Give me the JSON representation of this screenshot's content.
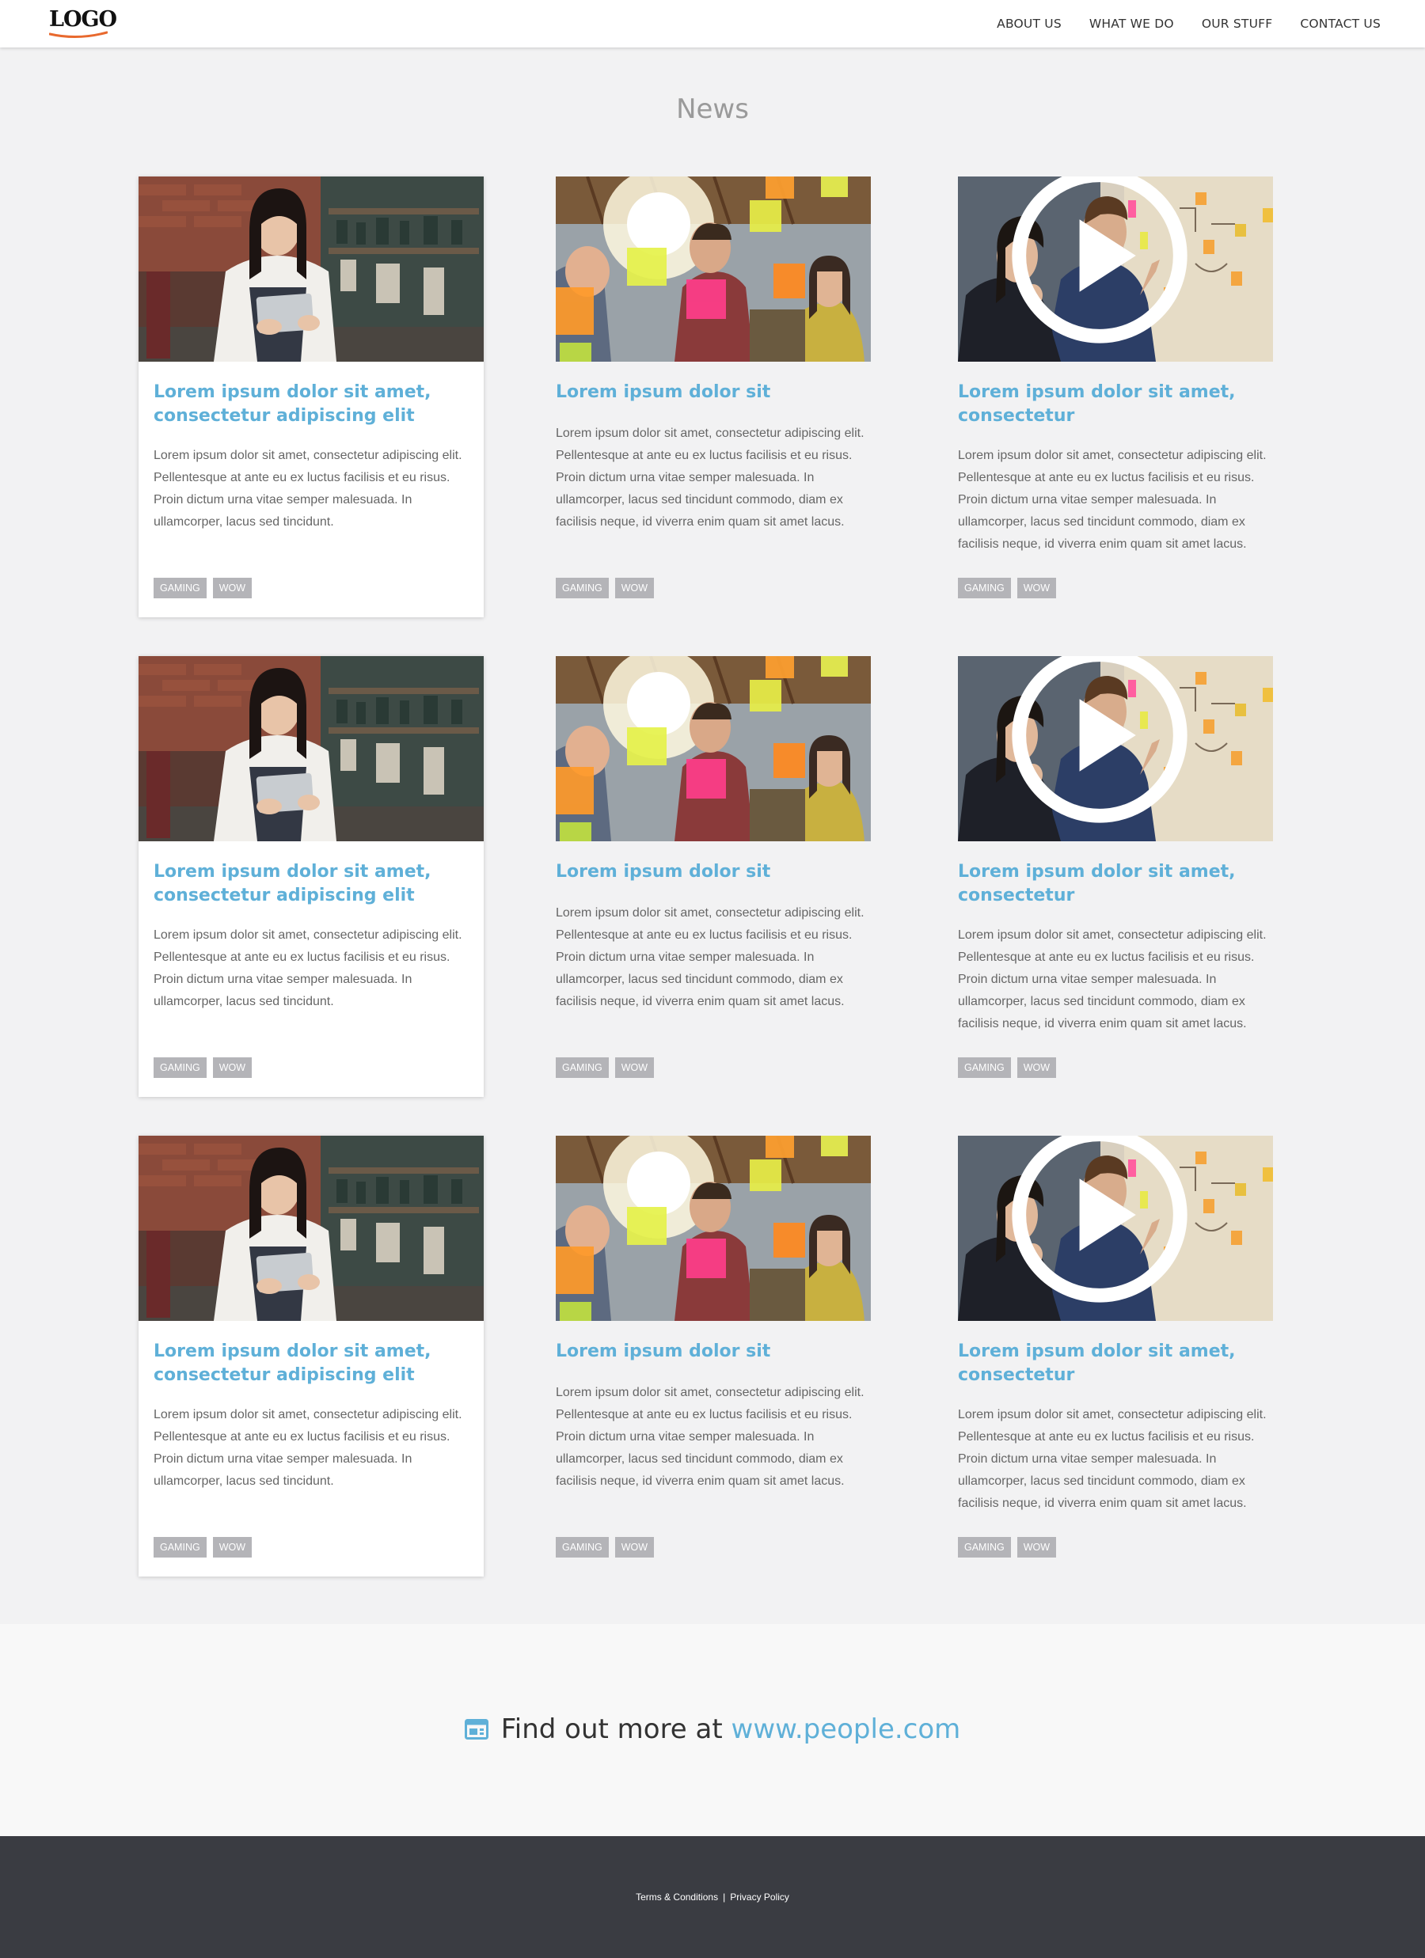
{
  "header": {
    "logo": "LOGO",
    "nav": [
      "ABOUT US",
      "WHAT WE DO",
      "OUR STUFF",
      "CONTACT US"
    ]
  },
  "page_title": "News",
  "cards": [
    {
      "image": "woman-with-tablet-photo",
      "title": "Lorem ipsum dolor sit amet, consectetur adipiscing elit",
      "text": "Lorem ipsum dolor sit amet, consectetur adipiscing elit. Pellentesque at ante eu ex luctus facilisis et eu risus. Proin dictum urna vitae semper malesuada. In ullamcorper, lacus sed tincidunt.",
      "tags": [
        "GAMING",
        "WOW"
      ]
    },
    {
      "image": "team-sticky-notes-glass-photo",
      "title": "Lorem ipsum dolor sit",
      "text": "Lorem ipsum dolor sit amet, consectetur adipiscing elit. Pellentesque at ante eu ex luctus facilisis et eu risus. Proin dictum urna vitae semper malesuada. In ullamcorper, lacus sed tincidunt commodo, diam ex facilisis neque, id viverra enim quam sit amet lacus.",
      "tags": [
        "GAMING",
        "WOW"
      ]
    },
    {
      "image": "couple-whiteboard-video-thumbnail",
      "title": "Lorem ipsum dolor sit amet, consectetur",
      "text": "Lorem ipsum dolor sit amet, consectetur adipiscing elit. Pellentesque at ante eu ex luctus facilisis et eu risus. Proin dictum urna vitae semper malesuada. In ullamcorper, lacus sed tincidunt commodo, diam ex facilisis neque, id viverra enim quam sit amet lacus.",
      "tags": [
        "GAMING",
        "WOW"
      ]
    },
    {
      "image": "woman-with-tablet-photo",
      "title": "Lorem ipsum dolor sit amet, consectetur adipiscing elit",
      "text": "Lorem ipsum dolor sit amet, consectetur adipiscing elit. Pellentesque at ante eu ex luctus facilisis et eu risus. Proin dictum urna vitae semper malesuada. In ullamcorper, lacus sed tincidunt.",
      "tags": [
        "GAMING",
        "WOW"
      ]
    },
    {
      "image": "team-sticky-notes-glass-photo",
      "title": "Lorem ipsum dolor sit",
      "text": "Lorem ipsum dolor sit amet, consectetur adipiscing elit. Pellentesque at ante eu ex luctus facilisis et eu risus. Proin dictum urna vitae semper malesuada. In ullamcorper, lacus sed tincidunt commodo, diam ex facilisis neque, id viverra enim quam sit amet lacus.",
      "tags": [
        "GAMING",
        "WOW"
      ]
    },
    {
      "image": "couple-whiteboard-video-thumbnail",
      "title": "Lorem ipsum dolor sit amet, consectetur",
      "text": "Lorem ipsum dolor sit amet, consectetur adipiscing elit. Pellentesque at ante eu ex luctus facilisis et eu risus. Proin dictum urna vitae semper malesuada. In ullamcorper, lacus sed tincidunt commodo, diam ex facilisis neque, id viverra enim quam sit amet lacus.",
      "tags": [
        "GAMING",
        "WOW"
      ]
    },
    {
      "image": "woman-with-tablet-photo",
      "title": "Lorem ipsum dolor sit amet, consectetur adipiscing elit",
      "text": "Lorem ipsum dolor sit amet, consectetur adipiscing elit. Pellentesque at ante eu ex luctus facilisis et eu risus. Proin dictum urna vitae semper malesuada. In ullamcorper, lacus sed tincidunt.",
      "tags": [
        "GAMING",
        "WOW"
      ]
    },
    {
      "image": "team-sticky-notes-glass-photo",
      "title": "Lorem ipsum dolor sit",
      "text": "Lorem ipsum dolor sit amet, consectetur adipiscing elit. Pellentesque at ante eu ex luctus facilisis et eu risus. Proin dictum urna vitae semper malesuada. In ullamcorper, lacus sed tincidunt commodo, diam ex facilisis neque, id viverra enim quam sit amet lacus.",
      "tags": [
        "GAMING",
        "WOW"
      ]
    },
    {
      "image": "couple-whiteboard-video-thumbnail",
      "title": "Lorem ipsum dolor sit amet, consectetur",
      "text": "Lorem ipsum dolor sit amet, consectetur adipiscing elit. Pellentesque at ante eu ex luctus facilisis et eu risus. Proin dictum urna vitae semper malesuada. In ullamcorper, lacus sed tincidunt commodo, diam ex facilisis neque, id viverra enim quam sit amet lacus.",
      "tags": [
        "GAMING",
        "WOW"
      ]
    }
  ],
  "find_more": {
    "icon": "browser-window-icon",
    "prefix": "Find out more at",
    "link": "www.people.com"
  },
  "footer": {
    "terms": "Terms & Conditions",
    "separator": "|",
    "privacy": "Privacy Policy"
  },
  "colors": {
    "accent": "#5fb0d8",
    "logo_swoosh": "#e8692e",
    "tag_bg": "#b4b4b8",
    "footer_bg": "#3a3c42",
    "page_bg": "#f2f2f3"
  }
}
